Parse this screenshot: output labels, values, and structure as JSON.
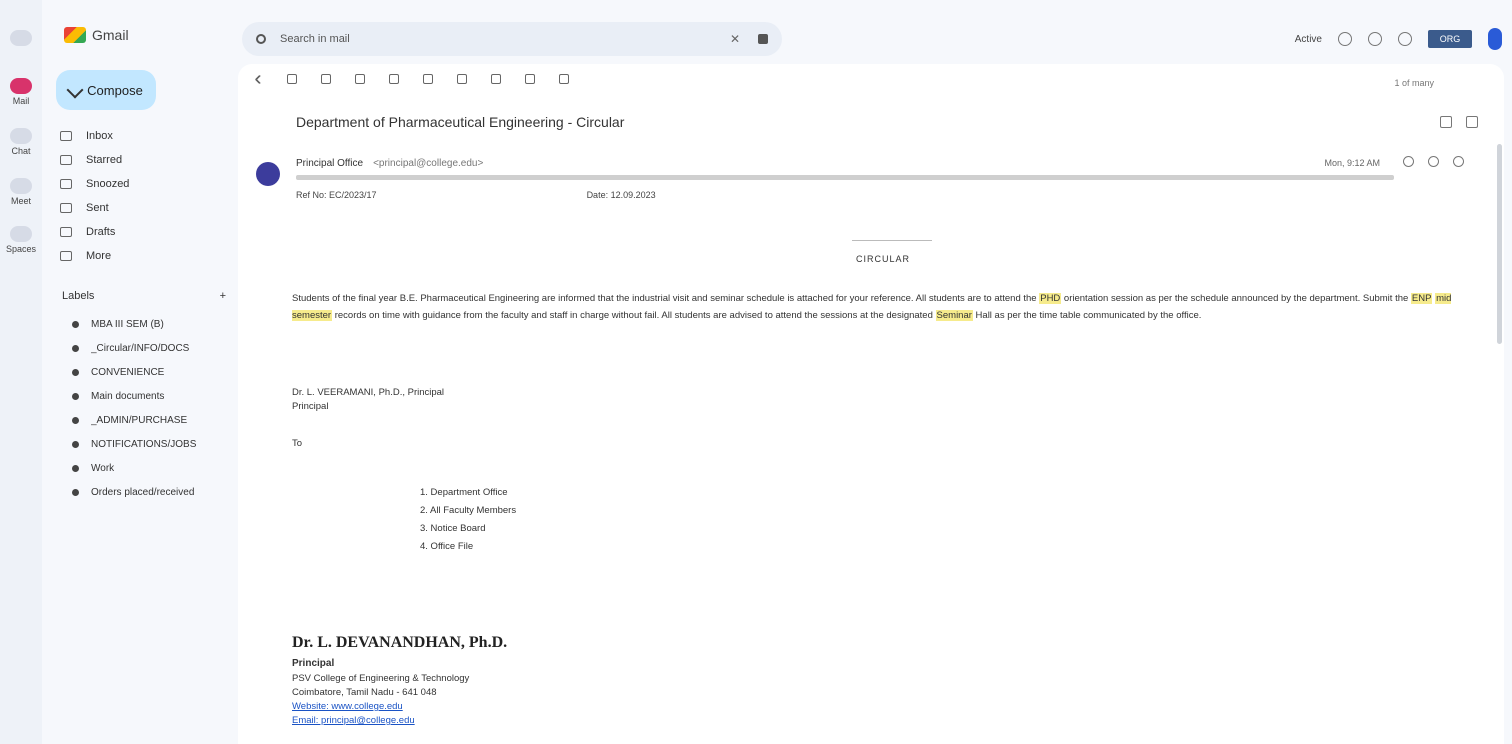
{
  "rail": {
    "items": [
      {
        "label": "Mail",
        "icon": "mail-icon"
      },
      {
        "label": "Chat",
        "icon": "chat-icon"
      },
      {
        "label": "Meet",
        "icon": "video-icon"
      },
      {
        "label": "Spaces",
        "icon": "spaces-icon"
      }
    ]
  },
  "sidebar": {
    "app_name": "Gmail",
    "compose_label": "Compose",
    "nav": [
      {
        "label": "Inbox",
        "count": "",
        "icon": "inbox-icon"
      },
      {
        "label": "Starred",
        "count": "",
        "icon": "star-icon"
      },
      {
        "label": "Snoozed",
        "count": "",
        "icon": "clock-icon"
      },
      {
        "label": "Sent",
        "count": "",
        "icon": "send-icon"
      },
      {
        "label": "Drafts",
        "count": "",
        "icon": "draft-icon"
      },
      {
        "label": "More",
        "count": "",
        "icon": "chevron-down-icon"
      }
    ],
    "labels_heading": "Labels",
    "labels_add": "+",
    "labels": [
      "MBA III SEM (B)",
      "_Circular/INFO/DOCS",
      "CONVENIENCE",
      "Main documents",
      "_ADMIN/PURCHASE",
      "NOTIFICATIONS/JOBS",
      "Work",
      "Orders placed/received"
    ]
  },
  "search": {
    "placeholder": "Search in mail",
    "value": "Search in mail",
    "clear_glyph": "✕"
  },
  "topbar": {
    "status": "Active",
    "org_badge": "ORG",
    "icons": [
      "help-icon",
      "settings-icon",
      "apps-icon"
    ]
  },
  "toolbar": {
    "pager": "1 of many",
    "icons": [
      "back-icon",
      "archive-icon",
      "report-icon",
      "delete-icon",
      "mark-unread-icon",
      "snooze-icon",
      "add-task-icon",
      "move-icon",
      "label-icon",
      "more-icon"
    ]
  },
  "message": {
    "subject": "Department of Pharmaceutical Engineering - Circular",
    "sender": "Principal Office",
    "sender_address": "<principal@college.edu>",
    "date": "Mon, 9:12 AM",
    "ref_no": "Ref No: EC/2023/17",
    "ref_date": "Date: 12.09.2023",
    "circular_title": "CIRCULAR",
    "body_paragraph_a": "Students of the final year B.E. Pharmaceutical Engineering are informed that the industrial visit and seminar schedule is attached for your reference. All students are to attend the ",
    "body_highlight_1": "PHD",
    "body_paragraph_b": " orientation session as per the schedule announced by the department. Submit the ",
    "body_highlight_2": "ENP",
    "body_highlight_3": "mid semester",
    "body_paragraph_c": " records on time with guidance from the faculty and staff in charge without fail.",
    "body_paragraph_d": "All students are advised to attend the sessions at the designated ",
    "body_highlight_4": "Seminar",
    "body_paragraph_e": " Hall as per the time table communicated by the office.",
    "signoff_1": "Dr. L. VEERAMANI, Ph.D., Principal",
    "signoff_2": "Principal",
    "to_label": "To",
    "to_list": [
      "1. Department Office",
      "2. All Faculty Members",
      "3. Notice Board",
      "4. Office File"
    ],
    "sig_name": "Dr. L. DEVANANDHAN, Ph.D.",
    "sig_role": "Principal",
    "sig_lines": [
      "PSV College of Engineering & Technology",
      "Coimbatore, Tamil Nadu - 641 048",
      "Website: www.college.edu",
      "Email: principal@college.edu"
    ]
  }
}
